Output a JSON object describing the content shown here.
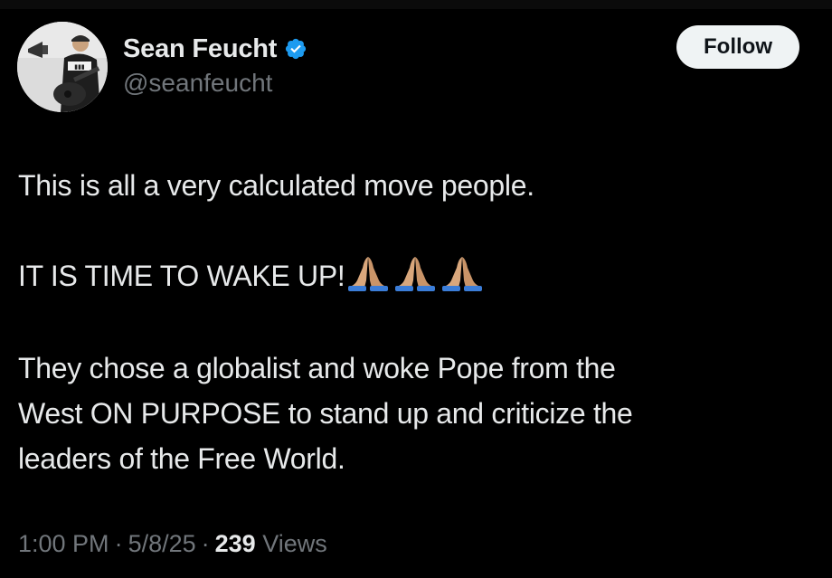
{
  "author": {
    "display_name": "Sean Feucht",
    "handle": "@seanfeucht",
    "verified": true,
    "verified_color": "#1d9bf0"
  },
  "follow_button": {
    "label": "Follow"
  },
  "tweet": {
    "lines": [
      "This is all a very calculated move people.",
      "IT IS TIME TO WAKE UP!",
      "They chose a globalist and woke Pope from the",
      "West ON PURPOSE to stand up and criticize the",
      "leaders of the Free World."
    ],
    "emoji": "🙏🏼🙏🏼🙏🏼"
  },
  "meta": {
    "time": "1:00 PM",
    "date": "5/8/25",
    "separator": "·",
    "views_count": "239",
    "views_label": "Views"
  },
  "colors": {
    "background": "#000000",
    "text": "#e7e9ea",
    "muted": "#71767b",
    "button_bg": "#eff3f4"
  }
}
